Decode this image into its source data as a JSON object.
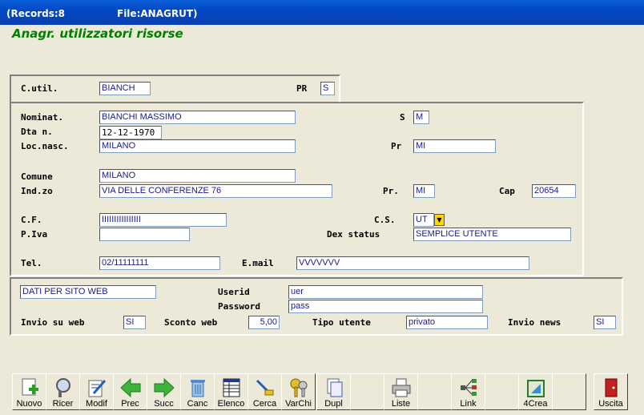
{
  "titlebar": {
    "records": "(Records:8",
    "file": "File:ANAGRUT)"
  },
  "heading": "Anagr. utilizzatori risorse",
  "fields": {
    "cutil_label": "C.util.",
    "cutil": "BIANCH",
    "pr_label": "PR",
    "pr": "S",
    "nominat_label": "Nominat.",
    "nominat": "BIANCHI MASSIMO",
    "s_label": "S",
    "s": "M",
    "dtan_label": "Dta n.",
    "dtan": "12-12-1970",
    "locnasc_label": "Loc.nasc.",
    "locnasc": "MILANO",
    "pr2_label": "Pr",
    "pr2": "MI",
    "comune_label": "Comune",
    "comune": "MILANO",
    "indzo_label": "Ind.zo",
    "indzo": "VIA DELLE CONFERENZE 76",
    "pr3_label": "Pr.",
    "pr3": "MI",
    "cap_label": "Cap",
    "cap": "20654",
    "cf_label": "C.F.",
    "cf": "IIIIIIIIIIIIIIII",
    "cs_label": "C.S.",
    "cs": "UT",
    "piva_label": "P.Iva",
    "piva": "",
    "dexstatus_label": "Dex status",
    "dexstatus": "SEMPLICE UTENTE",
    "tel_label": "Tel.",
    "tel": "02/11111111",
    "email_label": "E.mail",
    "email": "VVVVVVV"
  },
  "web": {
    "section": "DATI PER SITO WEB",
    "userid_label": "Userid",
    "userid": "uer",
    "password_label": "Password",
    "password": "pass",
    "invio_label": "Invio su web",
    "invio": "SI",
    "sconto_label": "Sconto web",
    "sconto": "5,00",
    "tipo_label": "Tipo utente",
    "tipo": "privato",
    "news_label": "Invio news",
    "news": "SI"
  },
  "toolbar": [
    {
      "label": "Nuovo",
      "icon": "new-icon"
    },
    {
      "label": "Ricer",
      "icon": "search-icon"
    },
    {
      "label": "Modif",
      "icon": "edit-icon"
    },
    {
      "label": "Prec",
      "icon": "arrow-left-icon"
    },
    {
      "label": "Succ",
      "icon": "arrow-right-icon"
    },
    {
      "label": "Canc",
      "icon": "trash-icon"
    },
    {
      "label": "Elenco",
      "icon": "list-icon"
    },
    {
      "label": "Cerca",
      "icon": "find-icon"
    },
    {
      "label": "VarChi",
      "icon": "keys-icon"
    },
    {
      "label": "Dupl",
      "icon": "duplicate-icon"
    },
    {
      "label": "",
      "icon": ""
    },
    {
      "label": "Liste",
      "icon": "printer-icon"
    },
    {
      "label": "",
      "icon": ""
    },
    {
      "label": "Link",
      "icon": "link-icon"
    },
    {
      "label": "",
      "icon": ""
    },
    {
      "label": "4Crea",
      "icon": "create-icon"
    },
    {
      "label": "",
      "icon": ""
    },
    {
      "label": "Uscita",
      "icon": "exit-icon"
    }
  ],
  "colors": {
    "accent_green": "#008000",
    "title_blue": "#0348c4"
  }
}
